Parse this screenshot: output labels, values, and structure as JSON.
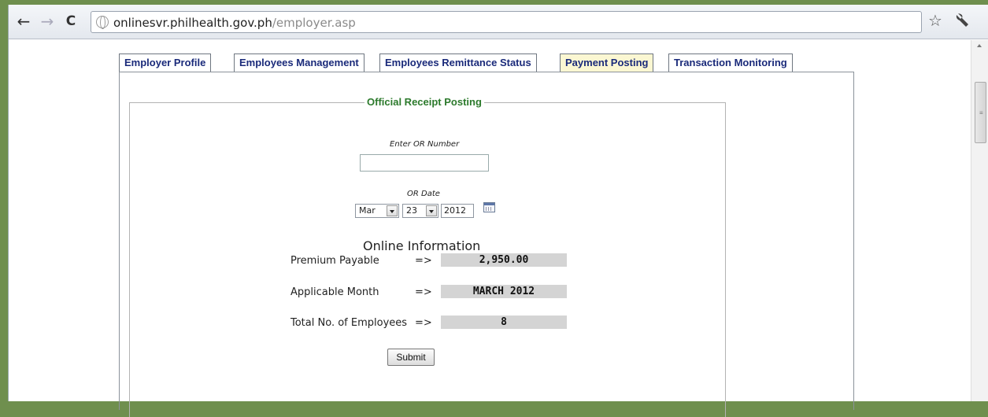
{
  "browser": {
    "back": "←",
    "forward": "→",
    "reload": "C",
    "url_host": "onlinesvr.philhealth.gov.ph",
    "url_path": "/employer.asp",
    "star": "☆",
    "wrench": "🔧"
  },
  "tabs": [
    {
      "label": "Employer Profile",
      "active": false
    },
    {
      "label": "Employees Management",
      "active": false
    },
    {
      "label": "Employees Remittance Status",
      "active": false
    },
    {
      "label": "Payment Posting",
      "active": true
    },
    {
      "label": "Transaction Monitoring",
      "active": false
    }
  ],
  "form": {
    "legend": "Official Receipt Posting",
    "or_number_label": "Enter OR Number",
    "or_number_value": "",
    "or_date_label": "OR Date",
    "month": "Mar",
    "day": "23",
    "year": "2012"
  },
  "online_info": {
    "title": "Online Information",
    "arrow": "=>",
    "premium_label": "Premium Payable",
    "premium_value": "2,950.00",
    "month_label": "Applicable Month",
    "month_value": "MARCH 2012",
    "employees_label": "Total No. of Employees",
    "employees_value": "8"
  },
  "submit_label": "Submit",
  "colors": {
    "tab_text": "#1a2a7a",
    "active_tab_bg": "#fbf7d2",
    "legend_green": "#2c7a2c",
    "value_box_bg": "#d4d4d4"
  }
}
